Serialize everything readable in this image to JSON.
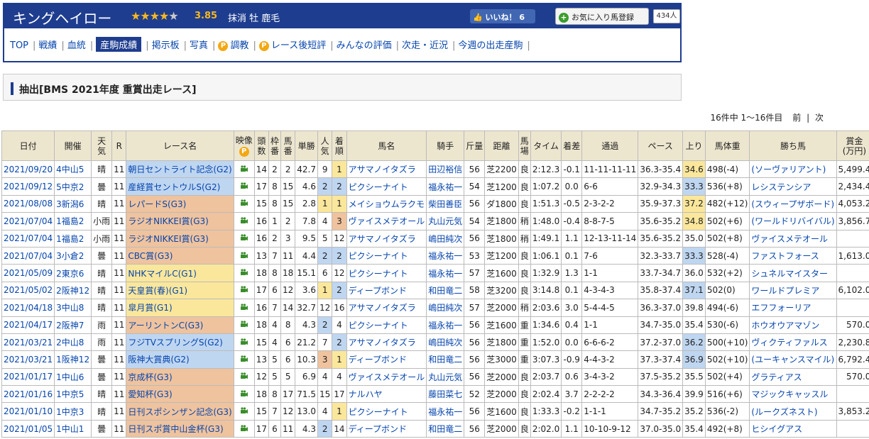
{
  "horse": {
    "name": "キングヘイロー",
    "stars": "★★★★",
    "star_empty": "★",
    "rating": "3.85",
    "info": "抹消 牡 鹿毛",
    "like_label": "いいね！ 6",
    "fav_label": "お気に入り馬登録",
    "fav_count": "434人"
  },
  "nav": [
    {
      "label": "TOP",
      "current": false,
      "premium": false
    },
    {
      "label": "戦績",
      "current": false,
      "premium": false
    },
    {
      "label": "血統",
      "current": false,
      "premium": false
    },
    {
      "label": "産駒成績",
      "current": true,
      "premium": false
    },
    {
      "label": "掲示板",
      "current": false,
      "premium": false
    },
    {
      "label": "写真",
      "current": false,
      "premium": false
    },
    {
      "label": "調教",
      "current": false,
      "premium": true
    },
    {
      "label": "レース後短評",
      "current": false,
      "premium": true
    },
    {
      "label": "みんなの評価",
      "current": false,
      "premium": false
    },
    {
      "label": "次走・近況",
      "current": false,
      "premium": false
    },
    {
      "label": "今週の出走産駒",
      "current": false,
      "premium": false
    }
  ],
  "premium_badge": "P",
  "section_title": "抽出[BMS 2021年度 重賞出走レース]",
  "pager": {
    "summary": "16件中 1〜16件目",
    "prev": "前",
    "sep": "|",
    "next": "次"
  },
  "colors": {
    "header_blue": "#1e3d8f",
    "g1": "#fbe79b",
    "g2": "#bfd6f1",
    "g3": "#efc39e",
    "th_bg": "#ede6cf"
  },
  "columns": [
    "日付",
    "開催",
    "天気",
    "R",
    "レース名",
    "映像",
    "頭数",
    "枠番",
    "馬番",
    "単勝",
    "人気",
    "着順",
    "馬名",
    "騎手",
    "斤量",
    "距離",
    "馬場",
    "タイム",
    "着差",
    "通過",
    "ペース",
    "上り",
    "馬体重",
    "勝ち馬",
    "賞金(万円)"
  ],
  "columns_display": {
    "weather": [
      "天",
      "気"
    ],
    "video": "映像",
    "heads": [
      "頭",
      "数"
    ],
    "waku": [
      "枠",
      "番"
    ],
    "umaban": [
      "馬",
      "番"
    ],
    "pop": [
      "人",
      "気"
    ],
    "chaku": [
      "着",
      "順"
    ],
    "baba": [
      "馬",
      "場"
    ],
    "prize": [
      "賞金",
      "(万円)"
    ]
  },
  "video_icon": "video-camera-icon",
  "rows": [
    [
      "2021/09/20",
      "4中山5",
      "晴",
      "11",
      "朝日セントライト記念(G2)",
      "14",
      "2",
      "2",
      "42.7",
      "9",
      "1",
      "アサマノイタズラ",
      "田辺裕信",
      "56",
      "芝2200",
      "良",
      "2:12.3",
      "-0.1",
      "11-11-11-11",
      "36.3-35.4",
      "34.6",
      "498(-4)",
      "(ソーヴァリアント)",
      "5,499.4"
    ],
    [
      "2021/09/12",
      "5中京2",
      "曇",
      "11",
      "産経賞セントウルS(G2)",
      "17",
      "8",
      "15",
      "4.6",
      "2",
      "2",
      "ピクシーナイト",
      "福永祐一",
      "54",
      "芝1200",
      "良",
      "1:07.2",
      "0.0",
      "6-6",
      "32.9-34.3",
      "33.3",
      "536(+8)",
      "レシステンシア",
      "2,434.4"
    ],
    [
      "2021/08/08",
      "3新潟6",
      "晴",
      "11",
      "レパードS(G3)",
      "15",
      "8",
      "15",
      "2.8",
      "1",
      "1",
      "メイショウムラクモ",
      "柴田善臣",
      "56",
      "ダ1800",
      "良",
      "1:51.3",
      "-0.5",
      "2-3-2-2",
      "35.9-37.3",
      "37.2",
      "482(+12)",
      "(スウィープザボード)",
      "4,053.2"
    ],
    [
      "2021/07/04",
      "1福島2",
      "小雨",
      "11",
      "ラジオNIKKEI賞(G3)",
      "16",
      "1",
      "2",
      "7.8",
      "4",
      "3",
      "ヴァイスメテオール",
      "丸山元気",
      "54",
      "芝1800",
      "稍",
      "1:48.0",
      "-0.4",
      "8-8-7-5",
      "35.6-35.2",
      "34.8",
      "502(+6)",
      "(ワールドリバイバル)",
      "3,856.7"
    ],
    [
      "2021/07/04",
      "1福島2",
      "小雨",
      "11",
      "ラジオNIKKEI賞(G3)",
      "16",
      "2",
      "3",
      "9.5",
      "5",
      "12",
      "アサマノイタズラ",
      "嶋田純次",
      "56",
      "芝1800",
      "稍",
      "1:49.1",
      "1.1",
      "12-13-11-14",
      "35.6-35.2",
      "35.0",
      "502(+8)",
      "ヴァイスメテオール",
      ""
    ],
    [
      "2021/07/04",
      "3小倉2",
      "曇",
      "11",
      "CBC賞(G3)",
      "13",
      "7",
      "11",
      "4.4",
      "2",
      "2",
      "ピクシーナイト",
      "福永祐一",
      "53",
      "芝1200",
      "良",
      "1:06.1",
      "0.1",
      "7-6",
      "32.3-33.7",
      "33.3",
      "528(-4)",
      "ファストフォース",
      "1,613.0"
    ],
    [
      "2021/05/09",
      "2東京6",
      "晴",
      "11",
      "NHKマイルC(G1)",
      "18",
      "8",
      "18",
      "15.1",
      "6",
      "12",
      "ピクシーナイト",
      "福永祐一",
      "57",
      "芝1600",
      "良",
      "1:32.9",
      "1.3",
      "1-1",
      "33.7-34.7",
      "36.0",
      "532(+2)",
      "シュネルマイスター",
      ""
    ],
    [
      "2021/05/02",
      "2阪神12",
      "晴",
      "11",
      "天皇賞(春)(G1)",
      "17",
      "6",
      "12",
      "3.6",
      "1",
      "2",
      "ディープボンド",
      "和田竜二",
      "58",
      "芝3200",
      "良",
      "3:14.8",
      "0.1",
      "4-3-4-3",
      "35.8-37.4",
      "37.1",
      "502(0)",
      "ワールドプレミア",
      "6,102.0"
    ],
    [
      "2021/04/18",
      "3中山8",
      "晴",
      "11",
      "皐月賞(G1)",
      "16",
      "7",
      "14",
      "32.7",
      "12",
      "16",
      "アサマノイタズラ",
      "嶋田純次",
      "57",
      "芝2000",
      "稍",
      "2:03.6",
      "3.0",
      "5-4-4-5",
      "36.3-37.0",
      "39.8",
      "494(-6)",
      "エフフォーリア",
      ""
    ],
    [
      "2021/04/17",
      "2阪神7",
      "雨",
      "11",
      "アーリントンC(G3)",
      "18",
      "4",
      "8",
      "4.3",
      "2",
      "4",
      "ピクシーナイト",
      "福永祐一",
      "56",
      "芝1600",
      "重",
      "1:34.6",
      "0.4",
      "1-1",
      "34.7-35.0",
      "35.4",
      "530(-6)",
      "ホウオウアマゾン",
      "570.0"
    ],
    [
      "2021/03/21",
      "2中山8",
      "雨",
      "11",
      "フジTVスプリングS(G2)",
      "15",
      "4",
      "6",
      "21.2",
      "7",
      "2",
      "アサマノイタズラ",
      "嶋田純次",
      "56",
      "芝1800",
      "重",
      "1:52.0",
      "0.0",
      "6-6-6-2",
      "37.2-37.0",
      "36.2",
      "500(+10)",
      "ヴィクティファルス",
      "2,230.8"
    ],
    [
      "2021/03/21",
      "1阪神12",
      "曇",
      "11",
      "阪神大賞典(G2)",
      "13",
      "5",
      "6",
      "10.3",
      "3",
      "1",
      "ディープボンド",
      "和田竜二",
      "56",
      "芝3000",
      "重",
      "3:07.3",
      "-0.9",
      "4-4-3-2",
      "37.3-37.4",
      "36.9",
      "502(+10)",
      "(ユーキャンスマイル)",
      "6,792.4"
    ],
    [
      "2021/01/17",
      "1中山6",
      "曇",
      "11",
      "京成杯(G3)",
      "12",
      "5",
      "5",
      "6.9",
      "4",
      "4",
      "ヴァイスメテオール",
      "丸山元気",
      "56",
      "芝2000",
      "良",
      "2:03.7",
      "0.6",
      "3-4-3-2",
      "37.5-35.2",
      "35.5",
      "502(+4)",
      "グラティアス",
      "570.0"
    ],
    [
      "2021/01/16",
      "1中京5",
      "晴",
      "11",
      "愛知杯(G3)",
      "18",
      "8",
      "17",
      "71.5",
      "15",
      "17",
      "ナルハヤ",
      "藤田菜七",
      "52",
      "芝2000",
      "良",
      "2:02.4",
      "3.7",
      "2-2-2-2",
      "34.3-36.4",
      "39.9",
      "516(+6)",
      "マジックキャッスル",
      ""
    ],
    [
      "2021/01/10",
      "1中京3",
      "晴",
      "11",
      "日刊スポシンザン記念(G3)",
      "15",
      "7",
      "12",
      "13.0",
      "4",
      "1",
      "ピクシーナイト",
      "福永祐一",
      "56",
      "芝1600",
      "良",
      "1:33.3",
      "-0.2",
      "1-1-1",
      "34.7-35.2",
      "35.2",
      "536(-2)",
      "(ルークズネスト)",
      "3,853.2"
    ],
    [
      "2021/01/05",
      "1中山1",
      "曇",
      "11",
      "日刊スポ賞中山金杯(G3)",
      "17",
      "6",
      "11",
      "4.3",
      "2",
      "14",
      "ディープボンド",
      "和田竜二",
      "56",
      "芝2000",
      "良",
      "2:02.0",
      "1.1",
      "10-10-9-12",
      "37.0-35.0",
      "35.4",
      "492(+8)",
      "ヒシイグアス",
      ""
    ]
  ],
  "grade_map": [
    "G2",
    "G2",
    "G3",
    "G3",
    "G3",
    "G3",
    "G1",
    "G1",
    "G1",
    "G3",
    "G2",
    "G2",
    "G3",
    "G3",
    "G3",
    "G3"
  ],
  "up_rank": [
    "1",
    "2",
    "1",
    "1",
    "",
    "2",
    "",
    "2",
    "",
    "",
    "2",
    "2",
    "",
    "",
    "",
    ""
  ]
}
